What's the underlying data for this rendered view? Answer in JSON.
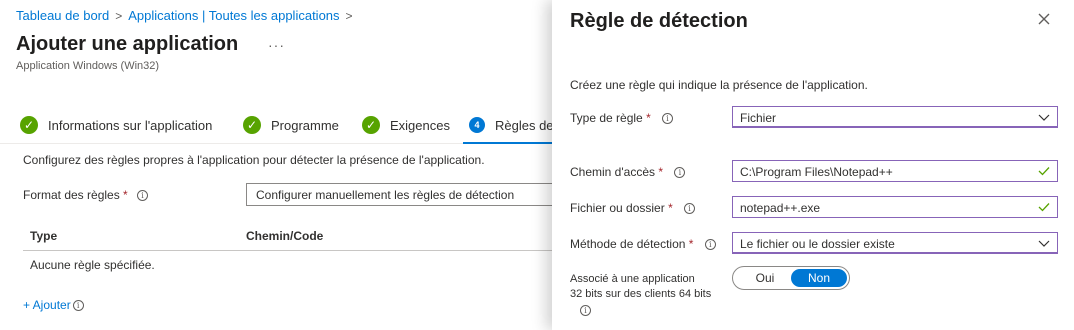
{
  "breadcrumb": {
    "items": [
      "Tableau de bord",
      "Applications | Toutes les applications"
    ],
    "separator": ">"
  },
  "page": {
    "title": "Ajouter une application",
    "more": "···",
    "subtitle": "Application Windows (Win32)"
  },
  "steps": [
    {
      "label": "Informations sur l'application",
      "state": "complete"
    },
    {
      "label": "Programme",
      "state": "complete"
    },
    {
      "label": "Exigences",
      "state": "complete"
    },
    {
      "label": "Règles de",
      "state": "current",
      "number": "4"
    }
  ],
  "detection": {
    "description": "Configurez des règles propres à l'application pour détecter la présence de l'application.",
    "format_label": "Format des règles",
    "format_value": "Configurer manuellement les règles de détection",
    "required_mark": "*",
    "info_glyph": "i",
    "table": {
      "columns": [
        "Type",
        "Chemin/Code"
      ],
      "empty_text": "Aucune règle spécifiée."
    },
    "add_label": "+ Ajouter"
  },
  "panel": {
    "title": "Règle de détection",
    "description": "Créez une règle qui indique la présence de l'application.",
    "fields": {
      "rule_type": {
        "label": "Type de règle",
        "value": "Fichier"
      },
      "path": {
        "label": "Chemin d'accès",
        "value": "C:\\Program Files\\Notepad++"
      },
      "file_or_folder": {
        "label": "Fichier ou dossier",
        "value": "notepad++.exe"
      },
      "detection_method": {
        "label": "Méthode de détection",
        "value": "Le fichier ou le dossier existe"
      },
      "associated_32bit": {
        "label_line1": "Associé à une application",
        "label_line2": "32 bits sur des clients 64 bits",
        "options": [
          "Oui",
          "Non"
        ],
        "selected": "Non"
      }
    }
  },
  "colors": {
    "accent": "#0078d4",
    "success": "#57a300",
    "required": "#a4262c",
    "focus_border": "#8764b8"
  }
}
